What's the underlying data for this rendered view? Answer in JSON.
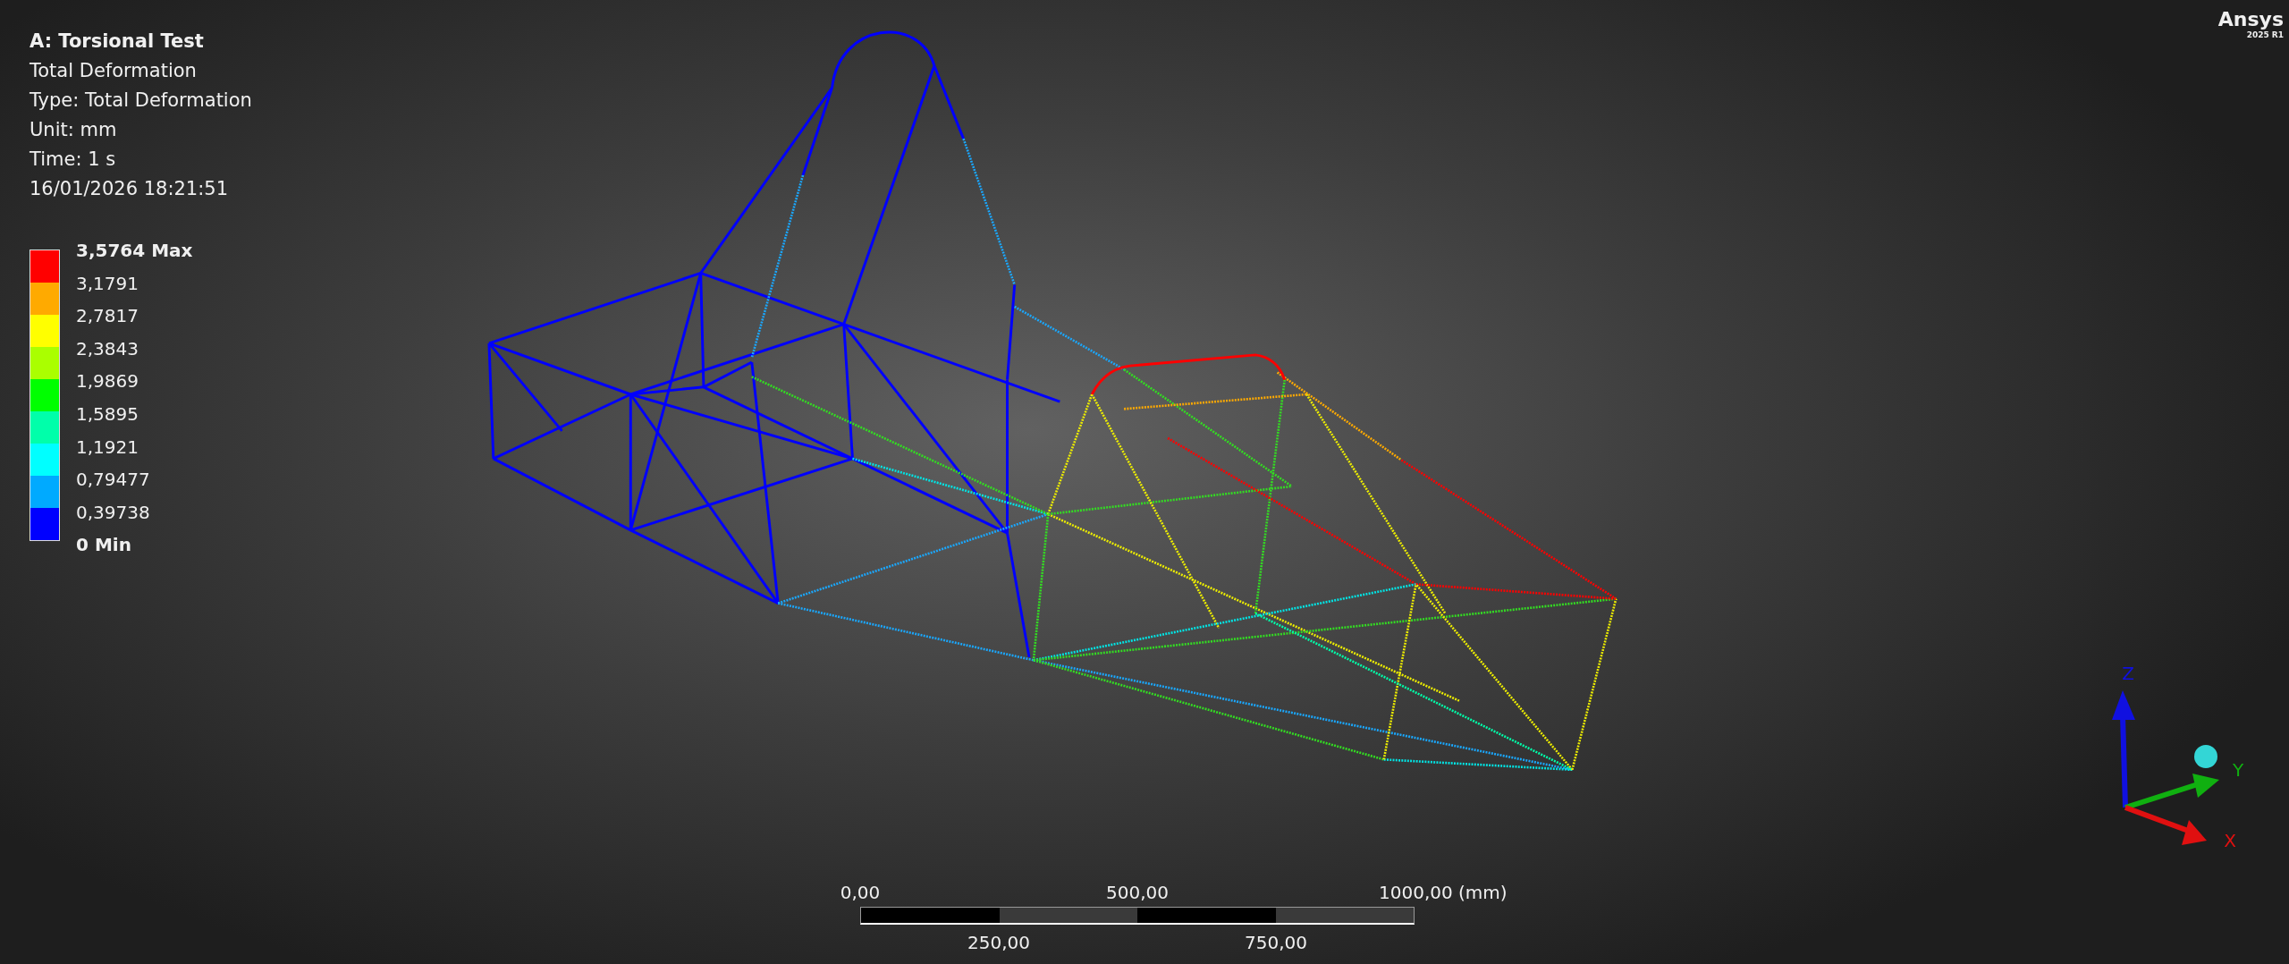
{
  "result_info": {
    "title": "A: Torsional Test",
    "lines": [
      "Total Deformation",
      "Type: Total Deformation",
      "Unit: mm",
      "Time: 1 s",
      "16/01/2026 18:21:51"
    ]
  },
  "legend": {
    "labels": [
      {
        "text": "3,5764 Max",
        "kind": "extreme"
      },
      {
        "text": "3,1791",
        "kind": "value"
      },
      {
        "text": "2,7817",
        "kind": "value"
      },
      {
        "text": "2,3843",
        "kind": "value"
      },
      {
        "text": "1,9869",
        "kind": "value"
      },
      {
        "text": "1,5895",
        "kind": "value"
      },
      {
        "text": "1,1921",
        "kind": "value"
      },
      {
        "text": "0,79477",
        "kind": "value"
      },
      {
        "text": "0,39738",
        "kind": "value"
      },
      {
        "text": "0 Min",
        "kind": "extreme"
      }
    ],
    "bands": [
      {
        "color": "#ff0000"
      },
      {
        "color": "#ffaa00"
      },
      {
        "color": "#ffff00"
      },
      {
        "color": "#aaff00"
      },
      {
        "color": "#00ff00"
      },
      {
        "color": "#00ffaa"
      },
      {
        "color": "#00ffff"
      },
      {
        "color": "#00aaff"
      },
      {
        "color": "#0000ff"
      }
    ]
  },
  "logo": {
    "name": "Ansys",
    "version": "2025 R1"
  },
  "scale_bar": {
    "top_labels": [
      "0,00",
      "500,00",
      "1000,00 (mm)"
    ],
    "bottom_labels": [
      "250,00",
      "750,00"
    ]
  },
  "triad": {
    "axes": [
      {
        "label": "Z",
        "kind": "z"
      },
      {
        "label": "Y",
        "kind": "y"
      },
      {
        "label": "X",
        "kind": "x"
      }
    ]
  }
}
